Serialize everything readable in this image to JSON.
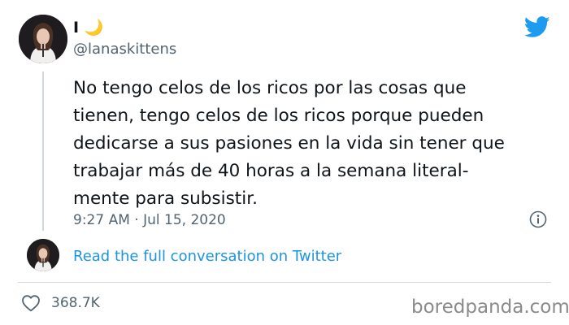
{
  "header": {
    "display_name": "I 🌙",
    "handle": "@lanaskittens"
  },
  "tweet": {
    "lines": [
      "No tengo celos de los ricos por las cosas que",
      "tienen, tengo celos de los ricos porque pueden",
      "dedicarse a sus pasiones en la vida sin tener que",
      "trabajar más de 40 horas a la semana literal-",
      "mente para subsistir."
    ],
    "timestamp": "9:27 AM · Jul 15, 2020"
  },
  "read_link": "Read the full conversation on Twitter",
  "stats": {
    "likes": "368.7K"
  },
  "watermark": "boredpanda.com",
  "colors": {
    "link": "#1b95e0",
    "twitter_blue": "#1d9bf0",
    "secondary_text": "#536471",
    "divider": "#cfd9de"
  },
  "icons": {
    "brand": "twitter-bird-icon",
    "info": "info-icon",
    "like": "heart-icon"
  }
}
